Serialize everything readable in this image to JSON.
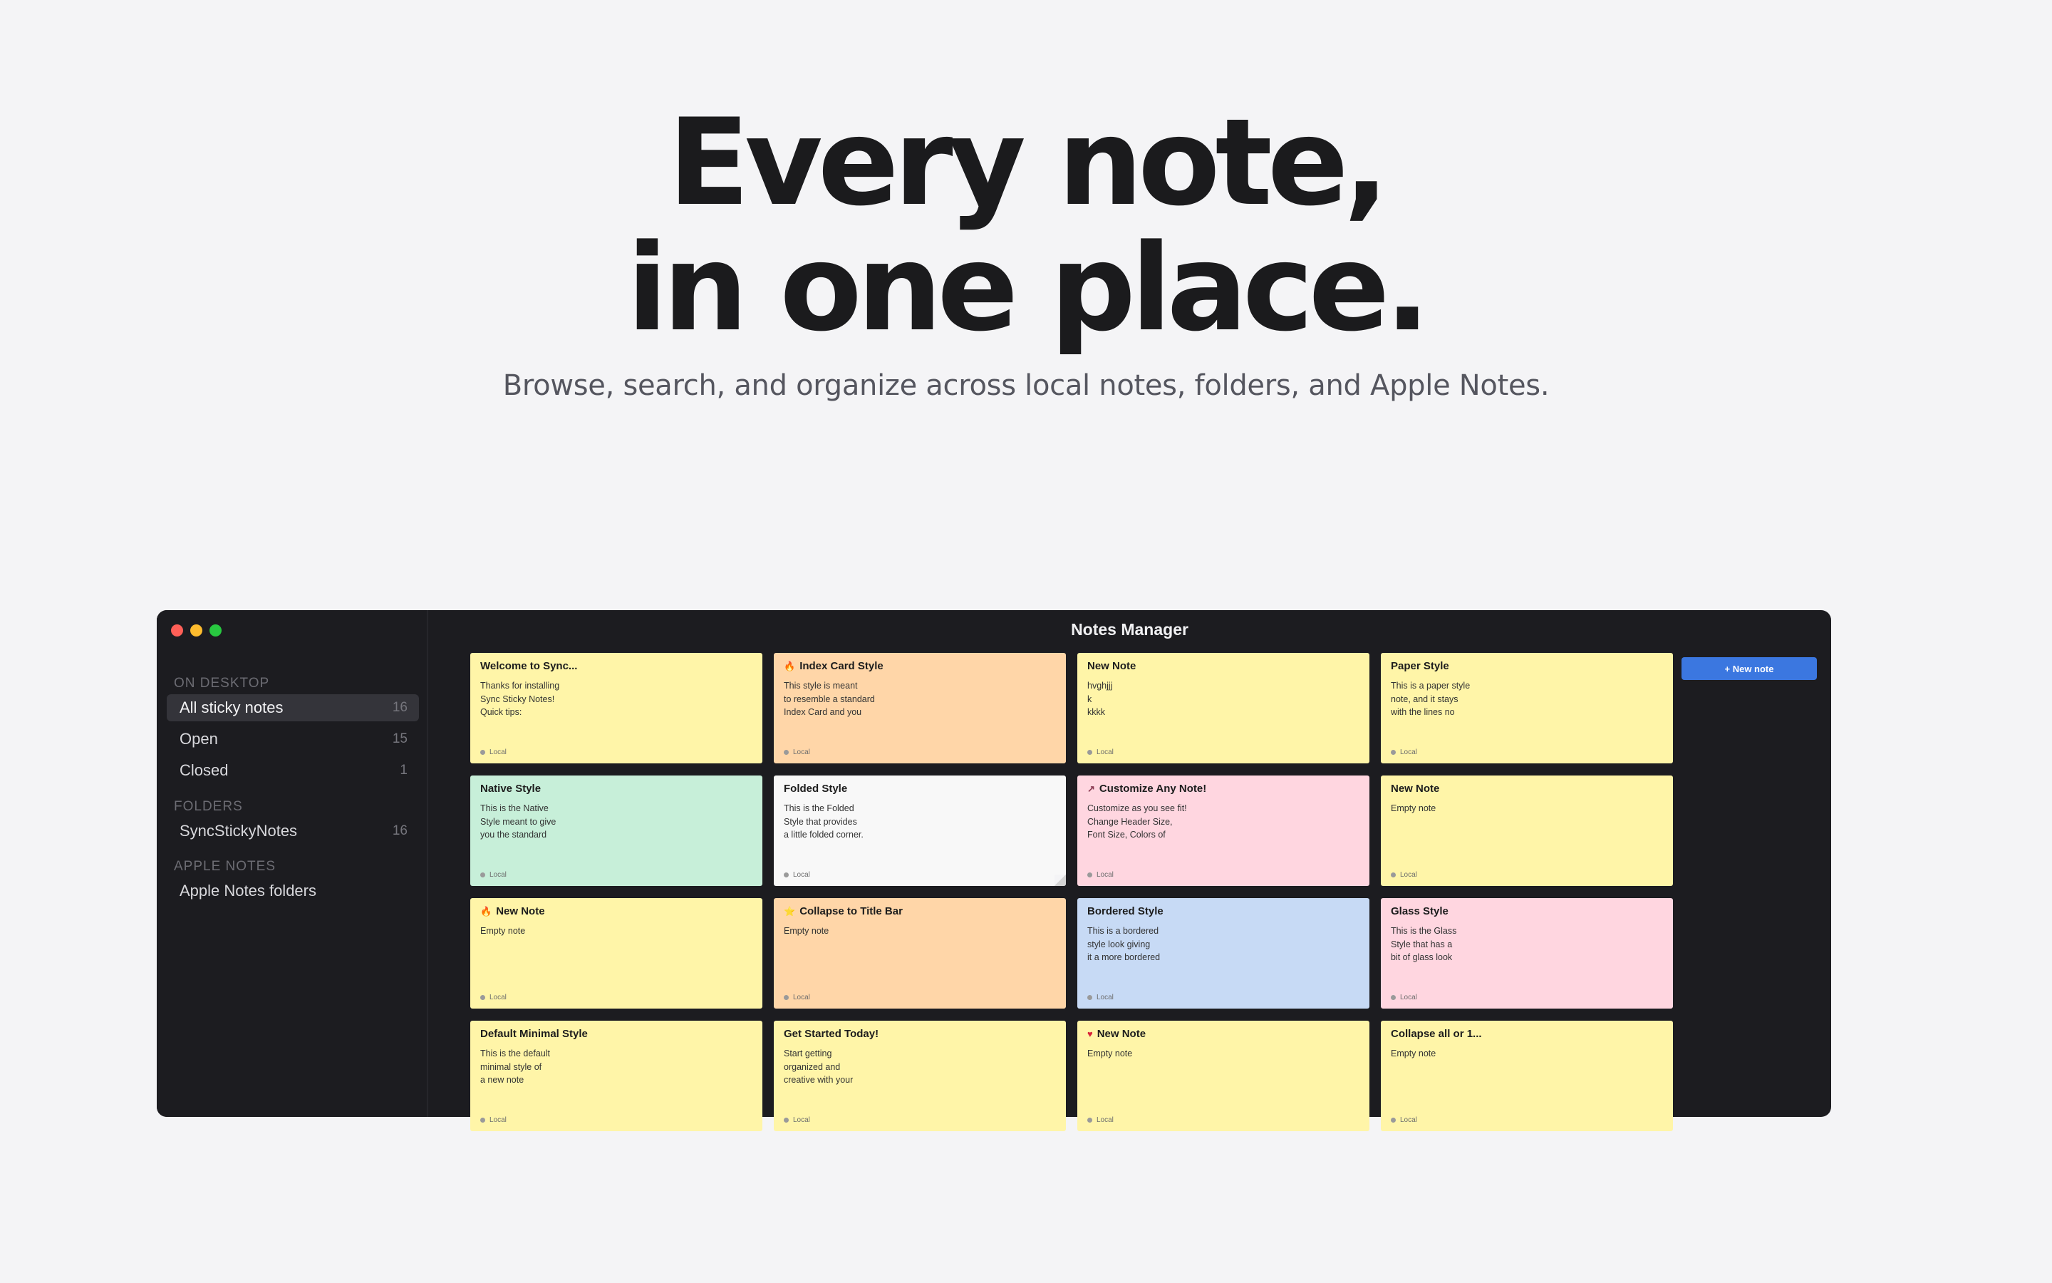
{
  "hero": {
    "title_line1": "Every note,",
    "title_line2": "in one place.",
    "subtitle": "Browse, search, and organize across local notes, folders, and Apple Notes."
  },
  "window": {
    "title": "Notes Manager",
    "new_note_label": "+ New note"
  },
  "sidebar": {
    "on_desktop_heading": "ON DESKTOP",
    "all_label": "All sticky notes",
    "all_count": "16",
    "open_label": "Open",
    "open_count": "15",
    "closed_label": "Closed",
    "closed_count": "1",
    "folders_heading": "FOLDERS",
    "folder_label": "SyncStickyNotes",
    "folder_count": "16",
    "apple_heading": "APPLE NOTES",
    "apple_label": "Apple Notes folders"
  },
  "colors": {
    "yellow": "#fff5a8",
    "orange": "#ffd6a8",
    "green": "#c7efd9",
    "white": "#f8f8f8",
    "pink": "#ffd6e0",
    "blue": "#c7daf5",
    "accent": "#3b77e0"
  },
  "notes": [
    {
      "title": "Welcome to Sync...",
      "icon": "",
      "body": "Thanks for installing\nSync Sticky Notes!\nQuick tips:",
      "source": "Local",
      "color": "yellow"
    },
    {
      "title": "Index Card Style",
      "icon": "🔥",
      "body": "This style is meant\nto resemble a standard\nIndex Card and you",
      "source": "Local",
      "color": "orange"
    },
    {
      "title": "New Note",
      "icon": "",
      "body": "hvghjjj\nk\nkkkk",
      "source": "Local",
      "color": "yellow"
    },
    {
      "title": "Paper Style",
      "icon": "",
      "body": "This is a paper style\nnote, and it stays\nwith the lines no",
      "source": "Local",
      "color": "yellow"
    },
    {
      "title": "Native Style",
      "icon": "",
      "body": "This is the Native\nStyle meant to give\nyou the standard",
      "source": "Local",
      "color": "green"
    },
    {
      "title": "Folded Style",
      "icon": "",
      "body": "This is the Folded\nStyle that provides\na little folded corner.",
      "source": "Local",
      "color": "white",
      "folded": true
    },
    {
      "title": "Customize Any Note!",
      "icon": "↗",
      "body": "Customize as you see fit!\nChange Header Size,\nFont Size, Colors of",
      "source": "Local",
      "color": "pink"
    },
    {
      "title": "New Note",
      "icon": "",
      "body": "Empty note",
      "source": "Local",
      "color": "yellow"
    },
    {
      "title": "New Note",
      "icon": "🔥",
      "body": "Empty note",
      "source": "Local",
      "color": "yellow"
    },
    {
      "title": "Collapse to Title Bar",
      "icon": "⭐",
      "body": "Empty note",
      "source": "Local",
      "color": "orange"
    },
    {
      "title": "Bordered Style",
      "icon": "",
      "body": "This is a bordered\nstyle look giving\nit a more bordered",
      "source": "Local",
      "color": "blue"
    },
    {
      "title": "Glass Style",
      "icon": "",
      "body": "This is the Glass\nStyle that has a\nbit of glass look",
      "source": "Local",
      "color": "pink"
    },
    {
      "title": "Default Minimal Style",
      "icon": "",
      "body": "This is the default\nminimal style of\na new note",
      "source": "Local",
      "color": "yellow"
    },
    {
      "title": "Get Started Today!",
      "icon": "",
      "body": "Start getting\norganized and\ncreative with your",
      "source": "Local",
      "color": "yellow"
    },
    {
      "title": "New Note",
      "icon": "♥",
      "body": "Empty note",
      "source": "Local",
      "color": "yellow"
    },
    {
      "title": "Collapse all or 1...",
      "icon": "",
      "body": "Empty note",
      "source": "Local",
      "color": "yellow"
    }
  ]
}
